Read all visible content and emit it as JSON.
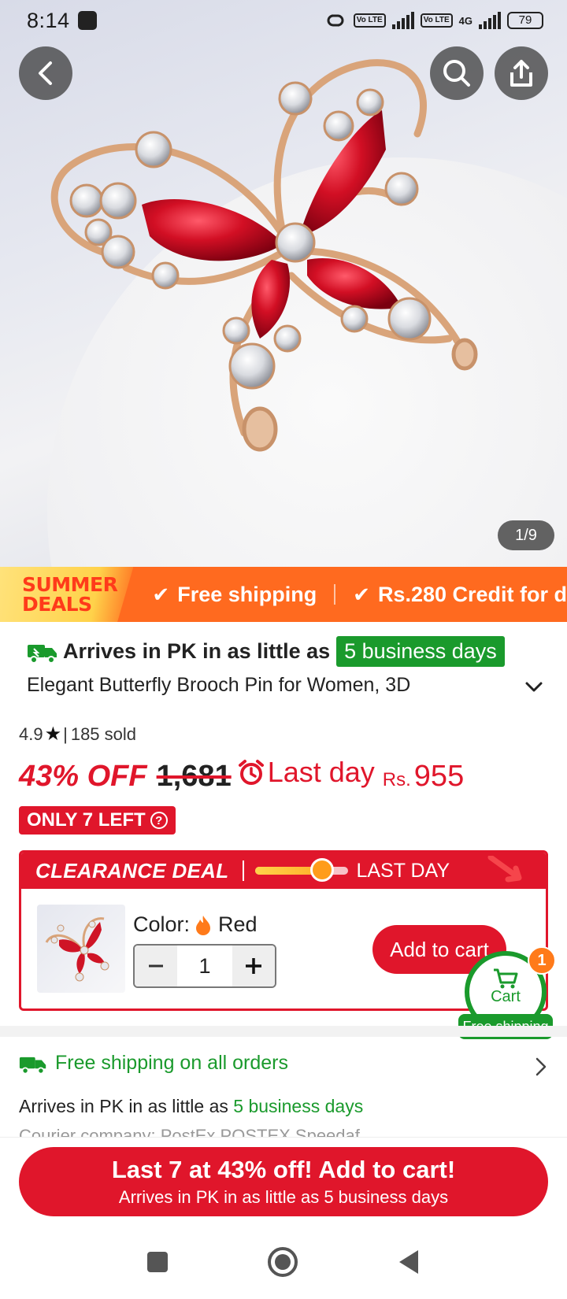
{
  "status_bar": {
    "time": "8:14",
    "network_badge_1": "Vo LTE",
    "network_badge_2": "Vo LTE",
    "network_type": "4G",
    "battery": "79"
  },
  "hero": {
    "image_counter": "1/9",
    "image_description_icon": "butterfly-brooch-image"
  },
  "promo_banner": {
    "badge_line1": "SUMMER",
    "badge_line2": "DEALS",
    "item1": "Free shipping",
    "item2": "Rs.280 Credit for d"
  },
  "product": {
    "arrives_prefix": "Arrives in PK in as little as",
    "arrives_days": "5 business days",
    "title": "Elegant Butterfly Brooch Pin for Women, 3D",
    "rating": "4.9",
    "sold": "185 sold",
    "discount": "43% OFF",
    "old_price": "1,681",
    "last_day": "Last day",
    "currency": "Rs.",
    "price": "955",
    "stock_badge": "ONLY 7 LEFT"
  },
  "clearance": {
    "title": "CLEARANCE DEAL",
    "label": "LAST DAY",
    "progress": 0.72,
    "color_label": "Color:",
    "color_value": "Red",
    "quantity": "1",
    "add_to_cart": "Add to cart"
  },
  "cart_float": {
    "label": "Cart",
    "count": "1",
    "shipping": "Free shipping"
  },
  "shipping": {
    "title": "Free shipping on all orders",
    "arrives_prefix": "Arrives in PK in as little as",
    "arrives_days": "5 business days",
    "courier": "Courier company: PostEx POSTEX Speedaf"
  },
  "cta": {
    "main": "Last 7 at 43% off! Add to cart!",
    "sub": "Arrives in PK in as little as 5 business days"
  },
  "colors": {
    "accent_red": "#e0162b",
    "promo_orange": "#ff6a1f",
    "ship_green": "#1a9a2c"
  }
}
